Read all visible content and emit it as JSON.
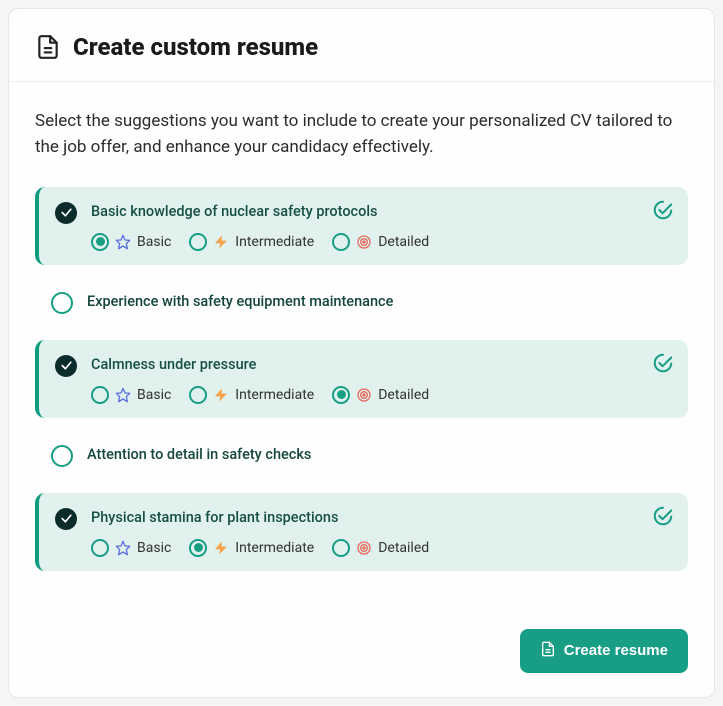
{
  "header": {
    "title": "Create custom resume"
  },
  "intro": "Select the suggestions you want to include to create your personalized CV tailored to the job offer, and enhance your candidacy effectively.",
  "levels": {
    "basic": "Basic",
    "intermediate": "Intermediate",
    "detailed": "Detailed"
  },
  "suggestions": [
    {
      "title": "Basic knowledge of nuclear safety protocols",
      "selected": true,
      "level": "basic"
    },
    {
      "title": "Experience with safety equipment maintenance",
      "selected": false,
      "level": null
    },
    {
      "title": "Calmness under pressure",
      "selected": true,
      "level": "detailed"
    },
    {
      "title": "Attention to detail in safety checks",
      "selected": false,
      "level": null
    },
    {
      "title": "Physical stamina for plant inspections",
      "selected": true,
      "level": "intermediate"
    }
  ],
  "actions": {
    "create": "Create resume"
  }
}
